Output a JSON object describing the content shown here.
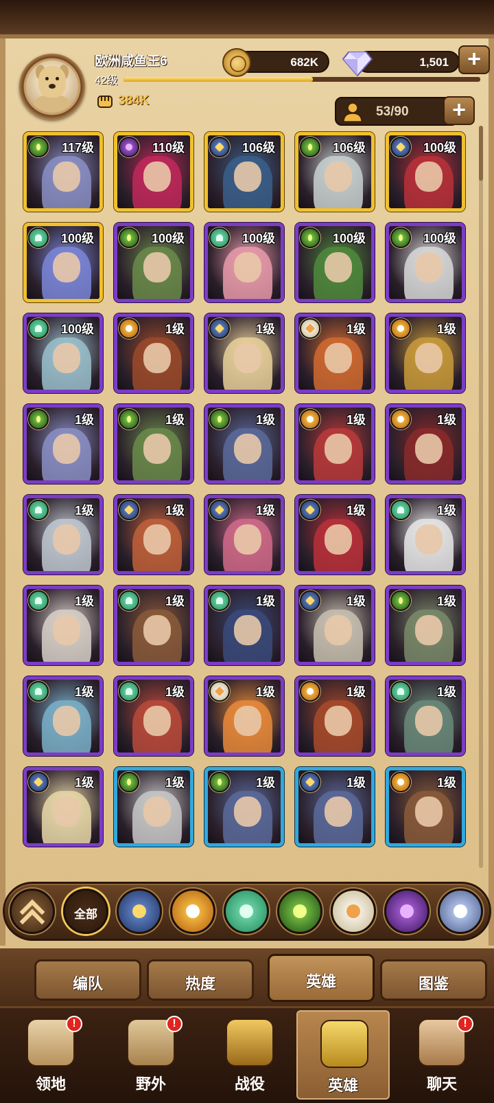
{
  "player": {
    "name": "欧洲咸鱼王6",
    "level": "42级",
    "xp_fraction": 0.53,
    "power": "384K"
  },
  "resources": {
    "gold": "682K",
    "diamonds": "1,501",
    "plus": "+"
  },
  "roster": {
    "count": "53/90",
    "plus": "+"
  },
  "heroes": [
    {
      "level": "117级",
      "faction": "graveborn",
      "tier": "gold",
      "tone": "#8a8fc4"
    },
    {
      "level": "110级",
      "faction": "hypogean",
      "tier": "gold",
      "tone": "#c0285a"
    },
    {
      "level": "106级",
      "faction": "lightbearer",
      "tier": "gold",
      "tone": "#3a5f8a"
    },
    {
      "level": "106级",
      "faction": "graveborn",
      "tier": "gold",
      "tone": "#c8d0cf"
    },
    {
      "level": "100级",
      "faction": "lightbearer",
      "tier": "gold",
      "tone": "#b8303a"
    },
    {
      "level": "100级",
      "faction": "wilder",
      "tier": "gold",
      "tone": "#7a86d8"
    },
    {
      "level": "100级",
      "faction": "graveborn",
      "tier": "purple",
      "tone": "#6a8a4a"
    },
    {
      "level": "100级",
      "faction": "wilder",
      "tier": "purple",
      "tone": "#e89aaa"
    },
    {
      "level": "100级",
      "faction": "graveborn",
      "tier": "purple",
      "tone": "#4f8a3c"
    },
    {
      "level": "100级",
      "faction": "graveborn",
      "tier": "purple",
      "tone": "#d8d8d8"
    },
    {
      "level": "100级",
      "faction": "wilder",
      "tier": "purple",
      "tone": "#9ac0cc"
    },
    {
      "level": "1级",
      "faction": "maulers",
      "tier": "purple",
      "tone": "#9a4a2a"
    },
    {
      "level": "1级",
      "faction": "lightbearer",
      "tier": "purple",
      "tone": "#e8d09a"
    },
    {
      "level": "1级",
      "faction": "celestial",
      "tier": "purple",
      "tone": "#d06a30"
    },
    {
      "level": "1级",
      "faction": "maulers",
      "tier": "purple",
      "tone": "#c89a3a"
    },
    {
      "level": "1级",
      "faction": "graveborn",
      "tier": "purple",
      "tone": "#8a8fc4"
    },
    {
      "level": "1级",
      "faction": "graveborn",
      "tier": "purple",
      "tone": "#6a8a4a"
    },
    {
      "level": "1级",
      "faction": "graveborn",
      "tier": "purple",
      "tone": "#5a6a9a"
    },
    {
      "level": "1级",
      "faction": "maulers",
      "tier": "purple",
      "tone": "#b83a3a"
    },
    {
      "level": "1级",
      "faction": "maulers",
      "tier": "purple",
      "tone": "#8a2a2a"
    },
    {
      "level": "1级",
      "faction": "wilder",
      "tier": "purple",
      "tone": "#c0c8d0"
    },
    {
      "level": "1级",
      "faction": "lightbearer",
      "tier": "purple",
      "tone": "#c0603a"
    },
    {
      "level": "1级",
      "faction": "lightbearer",
      "tier": "purple",
      "tone": "#d06a8a"
    },
    {
      "level": "1级",
      "faction": "lightbearer",
      "tier": "purple",
      "tone": "#b8303a"
    },
    {
      "level": "1级",
      "faction": "wilder",
      "tier": "purple",
      "tone": "#e8e8e8"
    },
    {
      "level": "1级",
      "faction": "wilder",
      "tier": "purple",
      "tone": "#d8d0c8"
    },
    {
      "level": "1级",
      "faction": "wilder",
      "tier": "purple",
      "tone": "#8a5a3a"
    },
    {
      "level": "1级",
      "faction": "wilder",
      "tier": "purple",
      "tone": "#3a4a7a"
    },
    {
      "level": "1级",
      "faction": "lightbearer",
      "tier": "purple",
      "tone": "#c8c0b0"
    },
    {
      "level": "1级",
      "faction": "graveborn",
      "tier": "purple",
      "tone": "#7a8a6a"
    },
    {
      "level": "1级",
      "faction": "wilder",
      "tier": "purple",
      "tone": "#7ab0c8"
    },
    {
      "level": "1级",
      "faction": "wilder",
      "tier": "purple",
      "tone": "#b84a3a"
    },
    {
      "level": "1级",
      "faction": "celestial",
      "tier": "purple",
      "tone": "#e88a3a"
    },
    {
      "level": "1级",
      "faction": "maulers",
      "tier": "purple",
      "tone": "#a84a2a"
    },
    {
      "level": "1级",
      "faction": "wilder",
      "tier": "purple",
      "tone": "#6a8a7a"
    },
    {
      "level": "1级",
      "faction": "lightbearer",
      "tier": "purple",
      "tone": "#e8d8a8"
    },
    {
      "level": "1级",
      "faction": "graveborn",
      "tier": "blue",
      "tone": "#c8c8c8"
    },
    {
      "level": "1级",
      "faction": "graveborn",
      "tier": "blue",
      "tone": "#5a6a9a"
    },
    {
      "level": "1级",
      "faction": "lightbearer",
      "tier": "blue",
      "tone": "#5a6a9a"
    },
    {
      "level": "1级",
      "faction": "maulers",
      "tier": "blue",
      "tone": "#8a5a3a"
    }
  ],
  "filters": {
    "all_label": "全部",
    "factions": [
      "lightbearer",
      "maulers",
      "wilder",
      "graveborn",
      "celestial",
      "hypogean",
      "dimensional"
    ]
  },
  "tabs": [
    "编队",
    "热度",
    "英雄",
    "图鉴"
  ],
  "active_tab": "英雄",
  "nav": [
    {
      "label": "领地",
      "icon": "castle-icon",
      "alert": true
    },
    {
      "label": "野外",
      "icon": "scroll-map-icon",
      "alert": true
    },
    {
      "label": "战役",
      "icon": "sword-crest-icon",
      "alert": false
    },
    {
      "label": "英雄",
      "icon": "helmet-icon",
      "alert": false
    },
    {
      "label": "聊天",
      "icon": "chat-bubble-icon",
      "alert": true
    }
  ],
  "alert_mark": "!",
  "colors": {
    "gold_frame": "#f0c02e",
    "purple_frame": "#7c3cc6",
    "blue_frame": "#31a8de",
    "parchment": "#e3c895",
    "alert": "#e0241e"
  }
}
